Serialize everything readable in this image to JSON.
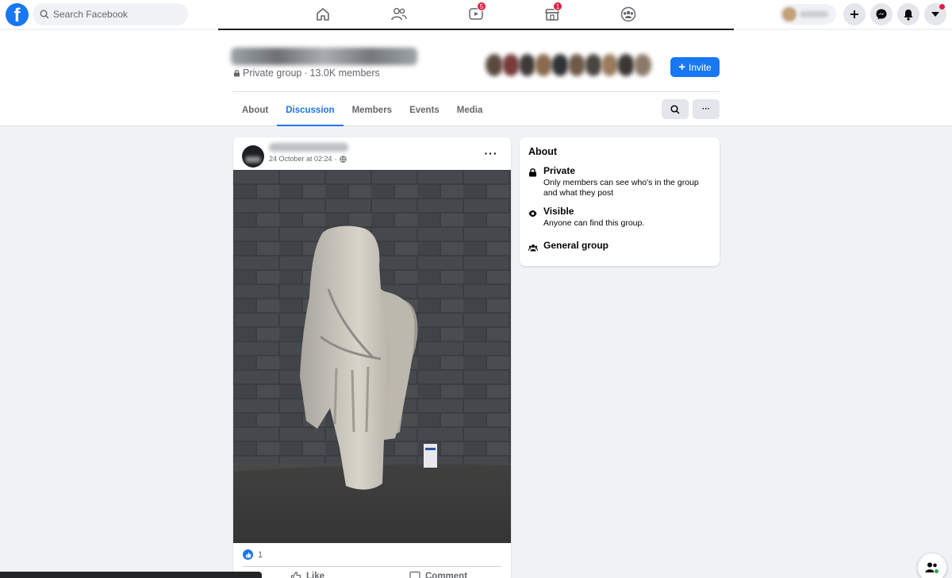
{
  "topbar": {
    "logo": "f",
    "search_placeholder": "Search Facebook",
    "nav_icons": [
      {
        "name": "home-icon",
        "badge": ""
      },
      {
        "name": "friends-icon",
        "badge": ""
      },
      {
        "name": "watch-icon",
        "badge": "5"
      },
      {
        "name": "marketplace-icon",
        "badge": "1"
      },
      {
        "name": "groups-icon",
        "badge": ""
      }
    ]
  },
  "group": {
    "privacy": "Private group",
    "separator": "·",
    "members": "13.0K members",
    "invite_label": "Invite",
    "tabs": [
      "About",
      "Discussion",
      "Members",
      "Events",
      "Media"
    ],
    "active_tab": "Discussion",
    "more_label": "···"
  },
  "post": {
    "timestamp": "24 October at 02:24",
    "meta_separator": "·",
    "more_label": "···",
    "reaction_count": "1",
    "like_label": "Like",
    "comment_label": "Comment"
  },
  "about": {
    "title": "About",
    "items": [
      {
        "icon": "lock-icon",
        "title": "Private",
        "desc": "Only members can see who's in the group and what they post"
      },
      {
        "icon": "eye-icon",
        "title": "Visible",
        "desc": "Anyone can find this group."
      },
      {
        "icon": "group-icon",
        "title": "General group",
        "desc": ""
      }
    ]
  },
  "colors": {
    "accent": "#1877f2",
    "badge": "#e41e3f",
    "page_bg": "#f0f2f5"
  }
}
